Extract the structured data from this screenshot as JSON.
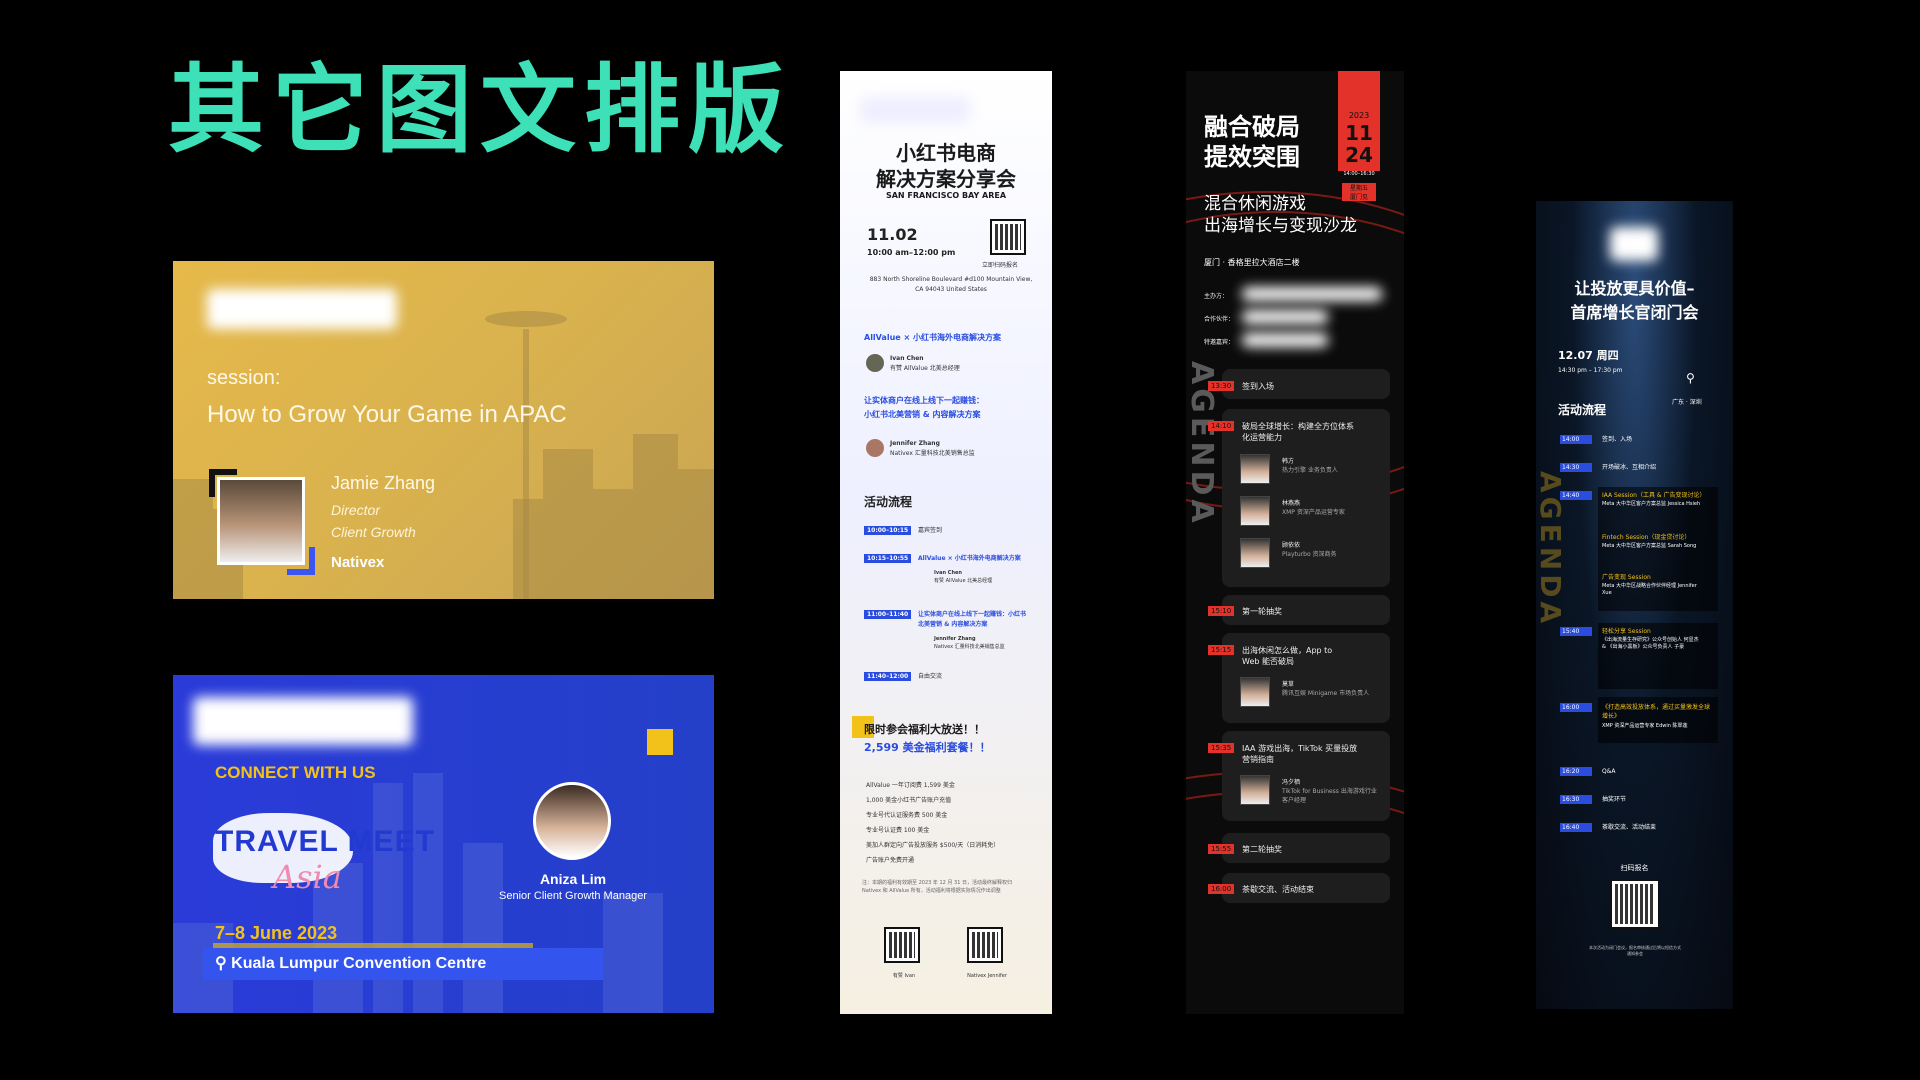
{
  "page": {
    "title": "其它图文排版"
  },
  "card_session": {
    "label": "session:",
    "talk": "How to Grow Your Game in APAC",
    "speaker": "Jamie Zhang",
    "role_line1": "Director",
    "role_line2": "Client Growth",
    "brand": "Nativex"
  },
  "card_travel": {
    "connect": "CONNECT WITH US",
    "event_line1": "TRAVEL MEET",
    "event_line2": "Asia",
    "dates": "7–8 June 2023",
    "venue": "Kuala Lumpur Convention Centre",
    "speaker": "Aniza Lim",
    "role": "Senior Client Growth Manager"
  },
  "poster_xhs": {
    "title1": "小红书电商",
    "title2": "解决方案分享会",
    "location": "SAN FRANCISCO BAY AREA",
    "date": "11.02",
    "time": "10:00 am–12:00 pm",
    "qr_caption": "立即扫码报名",
    "address": "883 North Shoreline Boulevard #d100 Mountain View, CA 94043 United States",
    "topic1": "AllValue × 小红书海外电商解决方案",
    "sp1_name": "Ivan Chen",
    "sp1_role": "有赞 AllValue 北美总经理",
    "topic2a": "让实体商户在线上线下一起赚钱：",
    "topic2b": "小红书北美营销 & 内容解决方案",
    "sp2_name": "Jennifer Zhang",
    "sp2_role": "Nativex 汇量科技北美销售总监",
    "agenda_title": "活动流程",
    "agenda": [
      {
        "time": "10:00–10:15",
        "title": "嘉宾签到"
      },
      {
        "time": "10:15–10:55",
        "title": "AllValue × 小红书海外电商解决方案",
        "speaker": "Ivan Chen",
        "role": "有赞 AllValue 北美总经理"
      },
      {
        "time": "11:00–11:40",
        "title": "让实体商户在线上线下一起赚钱：小红书北美营销 & 内容解决方案",
        "speaker": "Jennifer Zhang",
        "role": "Nativex 汇量科技北美销售总监"
      },
      {
        "time": "11:40–12:00",
        "title": "自由交流"
      }
    ],
    "benefit_title1": "限时参会福利大放送！！",
    "benefit_title2": "2,599 美金福利套餐！！",
    "benefits": [
      "AllValue 一年订阅费 1,599 美金",
      "1,000 美金小红书广告账户充值",
      "专业号代认证服务费 500 美金",
      "专业号认证费 100 美金",
      "美加人群定向广告投放服务 $500/天（日消耗免）",
      "广告账户免费开通"
    ],
    "note": "注：本期的福利有效期至 2023 年 12 月 31 日，活动最终解释权归 Nativex 和 AllValue 所有，活动福利将根据实际情况作出调整",
    "qr1_caption": "有赞 Ivan",
    "qr2_caption": "Nativex Jennifer"
  },
  "poster_game": {
    "title1": "融合破局",
    "title2": "提效突围",
    "year": "2023",
    "date_month": "11",
    "date_day": "24",
    "time": "14:00–16:30",
    "weekday": "星期五",
    "city": "厦门见",
    "subtitle1": "混合休闲游戏",
    "subtitle2": "出海增长与变现沙龙",
    "venue": "厦门 · 香格里拉大酒店二楼",
    "host_label": "主办方：",
    "partner_label": "合作伙伴：",
    "guest_label": "特邀嘉宾：",
    "agenda_word": "AGENDA",
    "items": [
      {
        "time": "13:30",
        "title": "签到入场"
      },
      {
        "time": "14:10",
        "title": "破局全球增长：构建全方位体系化运营能力"
      },
      {
        "time": "15:10",
        "title": "第一轮抽奖"
      },
      {
        "time": "15:15",
        "title": "出海休闲怎么做，App to Web 能否破局"
      },
      {
        "time": "15:35",
        "title": "IAA 游戏出海，TikTok 买量投放营销指南"
      },
      {
        "time": "15:55",
        "title": "第二轮抽奖"
      },
      {
        "time": "16:00",
        "title": "茶歇交流、活动结束"
      }
    ],
    "speakers": [
      {
        "name": "韩方",
        "role": "热力引擎 业务负责人"
      },
      {
        "name": "林燕燕",
        "role": "XMP 资深产品运营专家"
      },
      {
        "name": "顾依依",
        "role": "Playturbo 资深商务"
      },
      {
        "name": "莫草",
        "role": "腾讯互娱 Minigame 市场负责人"
      },
      {
        "name": "冯夕栖",
        "role": "TikTok for Business 出海游戏行业客户经理"
      }
    ]
  },
  "poster_ads": {
    "title1": "让投放更具价值–",
    "title2": "首席增长官闭门会",
    "date": "12.07 周四",
    "time": "14:30 pm – 17:30 pm",
    "city": "广东 · 深圳",
    "agenda_title": "活动流程",
    "agenda_word": "AGENDA",
    "items": [
      {
        "time": "14:00",
        "title": "签到、入场"
      },
      {
        "time": "14:30",
        "title": "开场破冰、互相介绍"
      },
      {
        "time": "14:40",
        "title": "IAA Session（工具 & 广告变现讨论）",
        "sub": "Meta 大中华区客户方案总监 Jessica Hsieh"
      },
      {
        "time": "",
        "title": "Fintech Session（现金贷讨论）",
        "sub": "Meta 大中华区客户方案总监 Sarah Song"
      },
      {
        "time": "",
        "title": "广告变现 Session",
        "sub": "Meta 大中华区战略合作伙伴经理 Jennifer Xue"
      },
      {
        "time": "15:40",
        "title": "轻松分享 Session",
        "sub": "《出海流量生存研究》公众号创始人 何显杰 & 《出海小黑板》公众号负责人 子豪"
      },
      {
        "time": "16:00",
        "title": "《打造高效投放体系，通过买量激发全球增长》",
        "sub": "XMP 资深产品运营专家 Edwin 陈翠莲"
      },
      {
        "time": "16:20",
        "title": "Q&A"
      },
      {
        "time": "16:30",
        "title": "抽奖环节"
      },
      {
        "time": "16:40",
        "title": "茶歇交流、活动结束"
      }
    ],
    "qr_title": "扫码报名",
    "note": "本次活动为闭门会议，报名审核通过后将以短信方式通知参会"
  }
}
